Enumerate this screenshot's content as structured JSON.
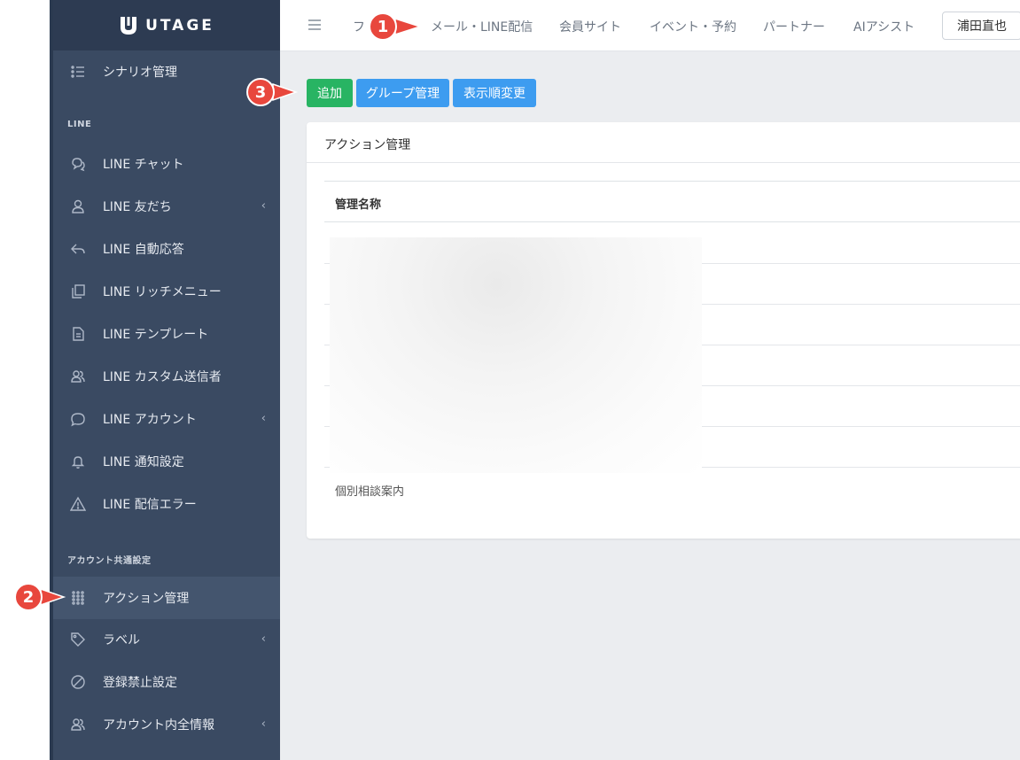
{
  "brand": {
    "name": "UTAGE"
  },
  "sidebar": {
    "top_item": {
      "label": "シナリオ管理",
      "icon": "list-icon"
    },
    "sections": [
      {
        "header": "LINE",
        "items": [
          {
            "label": "LINE チャット",
            "icon": "chat-icon",
            "has_chevron": false
          },
          {
            "label": "LINE 友だち",
            "icon": "person-icon",
            "has_chevron": true
          },
          {
            "label": "LINE 自動応答",
            "icon": "reply-icon",
            "has_chevron": false
          },
          {
            "label": "LINE リッチメニュー",
            "icon": "copy-icon",
            "has_chevron": false
          },
          {
            "label": "LINE テンプレート",
            "icon": "document-icon",
            "has_chevron": false
          },
          {
            "label": "LINE カスタム送信者",
            "icon": "people-icon",
            "has_chevron": false
          },
          {
            "label": "LINE アカウント",
            "icon": "speech-bubble-icon",
            "has_chevron": true
          },
          {
            "label": "LINE 通知設定",
            "icon": "bell-icon",
            "has_chevron": false
          },
          {
            "label": "LINE 配信エラー",
            "icon": "warning-icon",
            "has_chevron": false
          }
        ]
      },
      {
        "header": "アカウント共通設定",
        "items": [
          {
            "label": "アクション管理",
            "icon": "grid-dots-icon",
            "has_chevron": false,
            "active": true
          },
          {
            "label": "ラベル",
            "icon": "tag-icon",
            "has_chevron": true
          },
          {
            "label": "登録禁止設定",
            "icon": "ban-icon",
            "has_chevron": false
          },
          {
            "label": "アカウント内全情報",
            "icon": "people-icon",
            "has_chevron": true
          }
        ]
      }
    ],
    "chevron_glyph": "‹"
  },
  "topnav": {
    "items": [
      "フ",
      "メール・LINE配信",
      "会員サイト",
      "イベント・予約",
      "パートナー",
      "AIアシスト"
    ],
    "user_name": "浦田直也"
  },
  "toolbar": {
    "add_label": "追加",
    "group_label": "グループ管理",
    "order_label": "表示順変更"
  },
  "card": {
    "title": "アクション管理",
    "column_header": "管理名称",
    "visible_row": "個別相談案内"
  },
  "callouts": [
    "1",
    "2",
    "3"
  ],
  "colors": {
    "sidebar_bg": "#3a4a62",
    "sidebar_brand_bg": "#2d3b52",
    "active_item_bg": "#44556e",
    "add_button": "#28b463",
    "blue_button": "#3d9cf0",
    "callout_red": "#e8473d",
    "content_bg": "#ebedf0"
  }
}
